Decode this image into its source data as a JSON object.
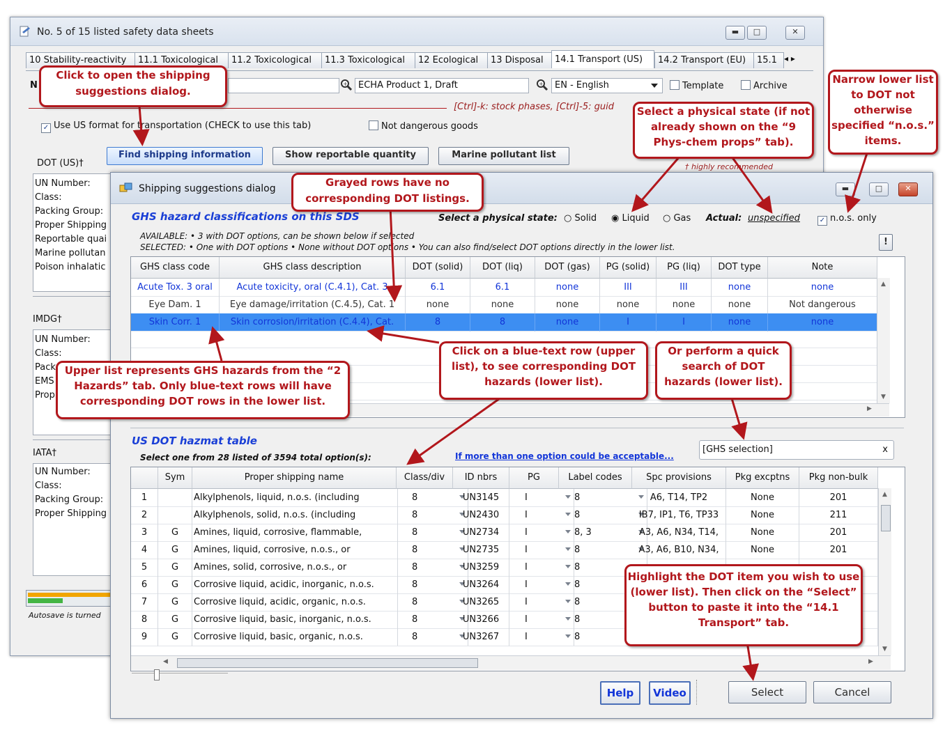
{
  "main_window": {
    "title": "No. 5 of 15 listed safety data sheets",
    "tabs": [
      "10 Stability-reactivity",
      "11.1 Toxicological",
      "11.2 Toxicological",
      "11.3 Toxicological",
      "12 Ecological",
      "13 Disposal",
      "14.1 Transport (US)",
      "14.2 Transport (EU)",
      "15.1"
    ],
    "search1_value": "ECHA Product 1, Draft",
    "language_value": "EN - English",
    "template_label": "Template",
    "archive_label": "Archive",
    "hint_text": "[Ctrl]-k: stock phases, [Ctrl]-5: guid",
    "use_us_format_label": "Use US format for transportation (CHECK to use this tab)",
    "not_dangerous_label": "Not dangerous goods",
    "find_shipping_button": "Find shipping information",
    "show_reportable_button": "Show reportable quantity",
    "marine_pollutant_button": "Marine pollutant list",
    "highly_recommended": "† highly recommended",
    "dot_label": "DOT (US)†",
    "dot_fields": [
      "UN Number:",
      "Class:",
      "Packing Group:",
      "Proper Shipping",
      "Reportable quai",
      "Marine pollutan",
      "Poison inhalatic"
    ],
    "imdg_label": "IMDG†",
    "imdg_fields": [
      "UN Number:",
      "Class:",
      "Pack",
      "EMS",
      "Prop"
    ],
    "iata_label": "IATA†",
    "iata_fields": [
      "UN Number:",
      "Class:",
      "Packing Group:",
      "Proper Shipping"
    ],
    "autosave_text": "Autosave is turned",
    "name_letter": "N"
  },
  "dialog": {
    "title": "Shipping suggestions dialog",
    "ghs_section_title": "GHS hazard classifications on this SDS",
    "physical_state_label": "Select a physical state:",
    "state_options": [
      "Solid",
      "Liquid",
      "Gas"
    ],
    "state_selected": "Liquid",
    "actual_label": "Actual:",
    "actual_value": "unspecified",
    "nos_only_label": "n.o.s. only",
    "available_text": "AVAILABLE:  • 3 with DOT options, can be shown below if selected",
    "selected_text": "SELECTED:  • One with DOT options  • None without DOT options  • You can also find/select DOT options directly in the lower list.",
    "ghs_columns": [
      "GHS class code",
      "GHS class description",
      "DOT (solid)",
      "DOT (liq)",
      "DOT (gas)",
      "PG (solid)",
      "PG (liq)",
      "DOT type",
      "Note"
    ],
    "ghs_rows": [
      {
        "code": "Acute Tox. 3 oral",
        "desc": "Acute toxicity, oral (C.4.1), Cat. 3",
        "dot_solid": "6.1",
        "dot_liq": "6.1",
        "dot_gas": "none",
        "pg_solid": "III",
        "pg_liq": "III",
        "dot_type": "none",
        "note": "none",
        "style": "blue"
      },
      {
        "code": "Eye Dam. 1",
        "desc": "Eye damage/irritation (C.4.5), Cat. 1",
        "dot_solid": "none",
        "dot_liq": "none",
        "dot_gas": "none",
        "pg_solid": "none",
        "pg_liq": "none",
        "dot_type": "none",
        "note": "Not dangerous",
        "style": "gray"
      },
      {
        "code": "Skin Corr. 1",
        "desc": "Skin corrosion/irritation (C.4.4), Cat.",
        "dot_solid": "8",
        "dot_liq": "8",
        "dot_gas": "none",
        "pg_solid": "I",
        "pg_liq": "I",
        "dot_type": "none",
        "note": "none",
        "style": "selected"
      }
    ],
    "dot_section_title": "US DOT hazmat table",
    "dot_subtitle": "Select one from 28 listed of 3594 total option(s):",
    "more_link": "If more than one option could be acceptable...",
    "search_value": "[GHS selection]",
    "search_clear": "x",
    "dot_columns": [
      "",
      "Sym",
      "Proper shipping name",
      "Class/div",
      "ID nbrs",
      "PG",
      "Label codes",
      "Spc provisions",
      "Pkg excptns",
      "Pkg non-bulk"
    ],
    "dot_rows": [
      {
        "n": "1",
        "sym": "",
        "name": "Alkylphenols, liquid, n.o.s. (including",
        "cls": "8",
        "id": "UN3145",
        "pg": "I",
        "lbl": "8",
        "spc": "A6, T14, TP2",
        "exc": "None",
        "nb": "201"
      },
      {
        "n": "2",
        "sym": "",
        "name": "Alkylphenols, solid, n.o.s. (including",
        "cls": "8",
        "id": "UN2430",
        "pg": "I",
        "lbl": "8",
        "spc": "IB7, IP1, T6, TP33",
        "exc": "None",
        "nb": "211"
      },
      {
        "n": "3",
        "sym": "G",
        "name": "Amines, liquid, corrosive, flammable,",
        "cls": "8",
        "id": "UN2734",
        "pg": "I",
        "lbl": "8, 3",
        "spc": "A3, A6, N34, T14,",
        "exc": "None",
        "nb": "201"
      },
      {
        "n": "4",
        "sym": "G",
        "name": "Amines, liquid, corrosive, n.o.s., or",
        "cls": "8",
        "id": "UN2735",
        "pg": "I",
        "lbl": "8",
        "spc": "A3, A6, B10, N34,",
        "exc": "None",
        "nb": "201"
      },
      {
        "n": "5",
        "sym": "G",
        "name": "Amines, solid, corrosive, n.o.s., or",
        "cls": "8",
        "id": "UN3259",
        "pg": "I",
        "lbl": "8",
        "spc": "",
        "exc": "",
        "nb": ""
      },
      {
        "n": "6",
        "sym": "G",
        "name": "Corrosive liquid, acidic, inorganic, n.o.s.",
        "cls": "8",
        "id": "UN3264",
        "pg": "I",
        "lbl": "8",
        "spc": "",
        "exc": "",
        "nb": ""
      },
      {
        "n": "7",
        "sym": "G",
        "name": "Corrosive liquid, acidic, organic, n.o.s.",
        "cls": "8",
        "id": "UN3265",
        "pg": "I",
        "lbl": "8",
        "spc": "",
        "exc": "",
        "nb": ""
      },
      {
        "n": "8",
        "sym": "G",
        "name": "Corrosive liquid, basic, inorganic, n.o.s.",
        "cls": "8",
        "id": "UN3266",
        "pg": "I",
        "lbl": "8",
        "spc": "",
        "exc": "",
        "nb": ""
      },
      {
        "n": "9",
        "sym": "G",
        "name": "Corrosive liquid, basic, organic, n.o.s.",
        "cls": "8",
        "id": "UN3267",
        "pg": "I",
        "lbl": "8",
        "spc": "",
        "exc": "",
        "nb": ""
      }
    ],
    "help_button": "Help",
    "video_button": "Video",
    "select_button": "Select",
    "cancel_button": "Cancel",
    "info_button": "!"
  },
  "callouts": {
    "open_dialog": "Click to open the shipping suggestions dialog.",
    "grayed_rows": "Grayed rows have no corresponding DOT listings.",
    "physical_state": "Select a physical state (if not already shown on the “9 Phys-chem props” tab).",
    "narrow_list": "Narrow lower list to DOT not otherwise specified “n.o.s.” items.",
    "upper_list": "Upper list represents GHS hazards from the “2 Hazards” tab. Only blue-text rows will have corresponding DOT rows in the lower list.",
    "click_blue": "Click on a blue-text row (upper list), to see corresponding DOT hazards (lower list).",
    "quick_search": "Or perform a quick search of DOT hazards (lower list).",
    "highlight": "Highlight the DOT item you wish to use (lower list). Then click on the “Select” button to paste it into the “14.1 Transport” tab."
  },
  "colors": {
    "callout_border": "#b2171c",
    "selected_row": "#3d8ef2",
    "blue_text": "#1235d8",
    "section_title": "#1a3fd6"
  },
  "icons": [
    "document-icon",
    "dialog-icon",
    "search-icon",
    "minimize-icon",
    "maximize-icon",
    "close-icon",
    "dropdown-icon",
    "scroll-arrow-icon"
  ]
}
